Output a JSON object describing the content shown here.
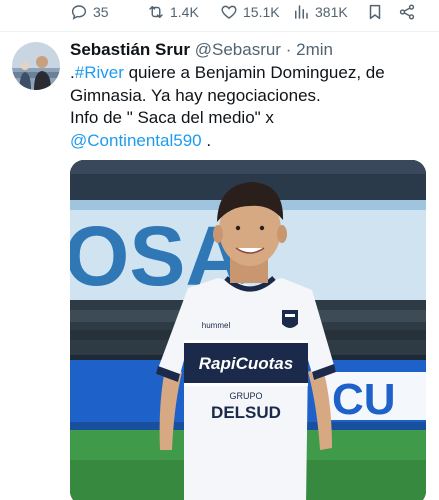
{
  "actions": {
    "reply_count": "35",
    "retweet_count": "1.4K",
    "like_count": "15.1K",
    "view_count": "381K"
  },
  "tweet": {
    "author_name": "Sebastián Srur",
    "author_handle": "@Sebasrur",
    "separator": "·",
    "time": "2min",
    "text_prefix": ".",
    "hashtag": "#River",
    "text_line1": " quiere a Benjamin Dominguez, de Gimnasia. Ya hay negociaciones.",
    "text_line2": "Info de  \" Saca del medio\" x",
    "mention": "@Continental590",
    "text_end": " ."
  },
  "photo": {
    "shirt_sponsor": "RapiCuotas",
    "shirt_sponsor2_line1": "GRUPO",
    "shirt_sponsor2_line2": "DELSUD",
    "shirt_brand": "hummel",
    "stand_banner": "OSA",
    "ad_board": "CU"
  },
  "colors": {
    "accent": "#1d9bf0",
    "muted": "#536471",
    "text": "#0f1419",
    "kit_navy": "#1b2a4a"
  }
}
